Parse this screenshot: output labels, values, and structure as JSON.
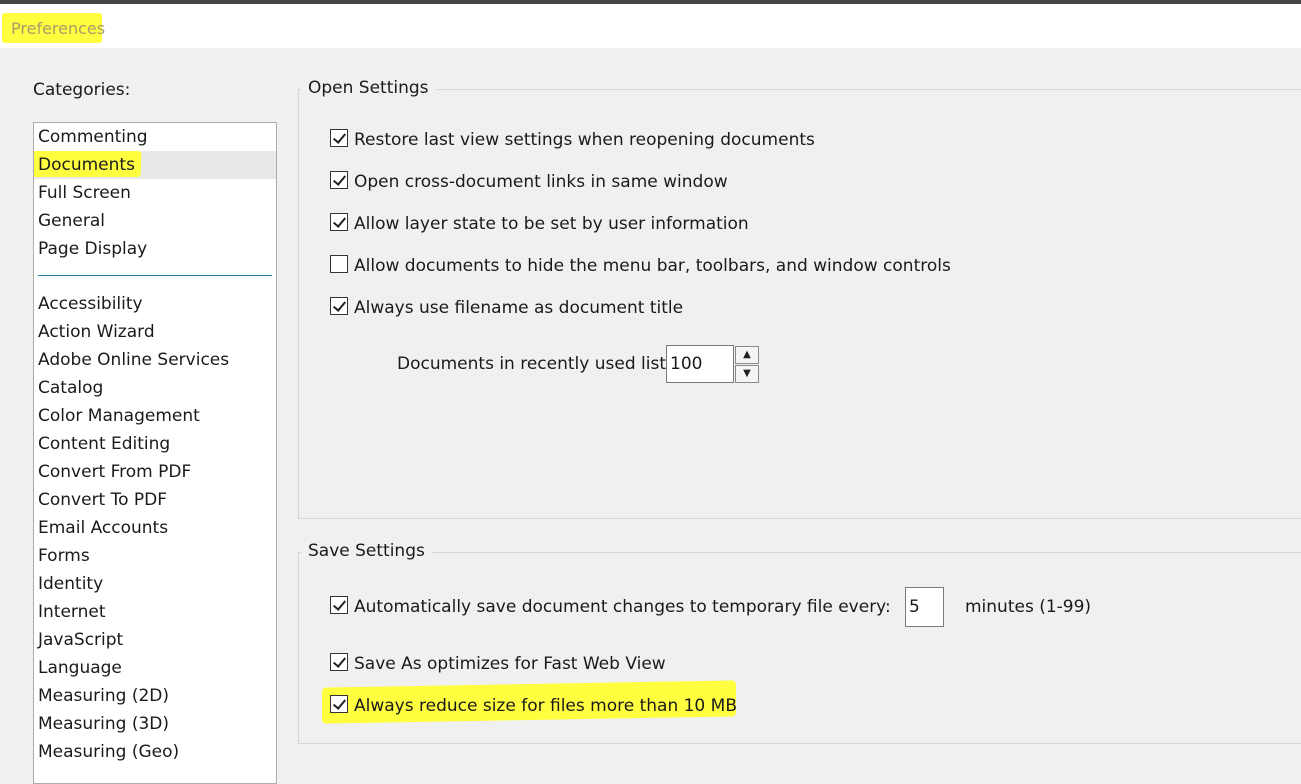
{
  "window": {
    "title": "Preferences"
  },
  "categories": {
    "label": "Categories:",
    "primary": [
      "Commenting",
      "Documents",
      "Full Screen",
      "General",
      "Page Display"
    ],
    "secondary": [
      "Accessibility",
      "Action Wizard",
      "Adobe Online Services",
      "Catalog",
      "Color Management",
      "Content Editing",
      "Convert From PDF",
      "Convert To PDF",
      "Email Accounts",
      "Forms",
      "Identity",
      "Internet",
      "JavaScript",
      "Language",
      "Measuring (2D)",
      "Measuring (3D)",
      "Measuring (Geo)"
    ],
    "selected": "Documents"
  },
  "open_settings": {
    "title": "Open Settings",
    "restore_last_view": {
      "label": "Restore last view settings when reopening documents",
      "checked": true
    },
    "cross_doc_links": {
      "label": "Open cross-document links in same window",
      "checked": true
    },
    "layer_state": {
      "label": "Allow layer state to be set by user information",
      "checked": true
    },
    "hide_menu_bar": {
      "label": "Allow documents to hide the menu bar, toolbars, and window controls",
      "checked": false
    },
    "filename_title": {
      "label": "Always use filename as document title",
      "checked": true
    },
    "recent_list_label": "Documents in recently used list:",
    "recent_list_value": "100"
  },
  "save_settings": {
    "title": "Save Settings",
    "autosave": {
      "label": "Automatically save document changes to temporary file every:",
      "checked": true
    },
    "autosave_value": "5",
    "autosave_unit": "minutes (1-99)",
    "fast_web_view": {
      "label": "Save As optimizes for Fast Web View",
      "checked": true
    },
    "reduce_size": {
      "label": "Always reduce size for files more than 10 MB",
      "checked": true
    }
  },
  "icons": {
    "spin_up": "▲",
    "spin_down": "▼"
  },
  "colors": {
    "highlight": "#ffff40",
    "separator": "#2a7fa8"
  }
}
